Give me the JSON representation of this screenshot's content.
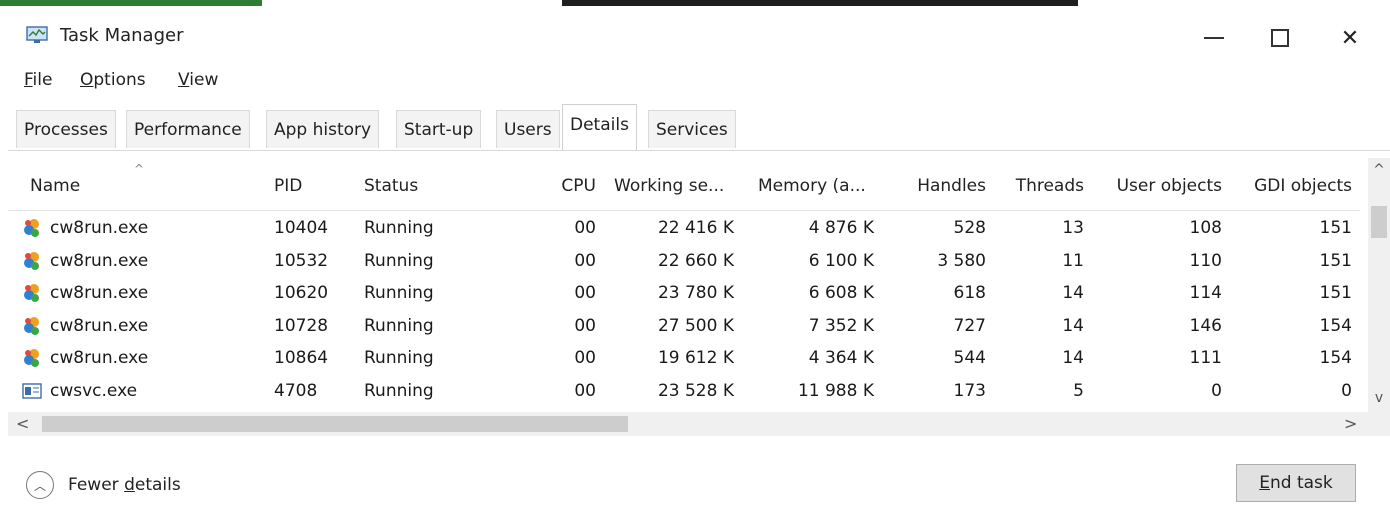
{
  "window": {
    "title": "Task Manager",
    "controls": {
      "minimize_icon": "minimize-icon",
      "maximize_icon": "maximize-icon",
      "close_label": "✕"
    }
  },
  "menu": {
    "file": {
      "first": "F",
      "rest": "ile"
    },
    "options": {
      "first": "O",
      "rest": "ptions"
    },
    "view": {
      "first": "V",
      "rest": "iew"
    }
  },
  "tabs": [
    "Processes",
    "Performance",
    "App history",
    "Start-up",
    "Users",
    "Details",
    "Services"
  ],
  "active_tab": "Details",
  "table": {
    "columns": {
      "name": "Name",
      "pid": "PID",
      "status": "Status",
      "cpu": "CPU",
      "working_set": "Working se...",
      "memory": "Memory (a...",
      "handles": "Handles",
      "threads": "Threads",
      "user_objects": "User objects",
      "gdi_objects": "GDI objects"
    },
    "sort_indicator": "^",
    "rows": [
      {
        "icon": "cw8run-icon",
        "name": "cw8run.exe",
        "pid": "10404",
        "status": "Running",
        "cpu": "00",
        "working_set": "22 416 K",
        "memory": "4 876 K",
        "handles": "528",
        "threads": "13",
        "user_objects": "108",
        "gdi_objects": "151"
      },
      {
        "icon": "cw8run-icon",
        "name": "cw8run.exe",
        "pid": "10532",
        "status": "Running",
        "cpu": "00",
        "working_set": "22 660 K",
        "memory": "6 100 K",
        "handles": "3 580",
        "threads": "11",
        "user_objects": "110",
        "gdi_objects": "151"
      },
      {
        "icon": "cw8run-icon",
        "name": "cw8run.exe",
        "pid": "10620",
        "status": "Running",
        "cpu": "00",
        "working_set": "23 780 K",
        "memory": "6 608 K",
        "handles": "618",
        "threads": "14",
        "user_objects": "114",
        "gdi_objects": "151"
      },
      {
        "icon": "cw8run-icon",
        "name": "cw8run.exe",
        "pid": "10728",
        "status": "Running",
        "cpu": "00",
        "working_set": "27 500 K",
        "memory": "7 352 K",
        "handles": "727",
        "threads": "14",
        "user_objects": "146",
        "gdi_objects": "154"
      },
      {
        "icon": "cw8run-icon",
        "name": "cw8run.exe",
        "pid": "10864",
        "status": "Running",
        "cpu": "00",
        "working_set": "19 612 K",
        "memory": "4 364 K",
        "handles": "544",
        "threads": "14",
        "user_objects": "111",
        "gdi_objects": "154"
      },
      {
        "icon": "service-icon",
        "name": "cwsvc.exe",
        "pid": "4708",
        "status": "Running",
        "cpu": "00",
        "working_set": "23 528 K",
        "memory": "11 988 K",
        "handles": "173",
        "threads": "5",
        "user_objects": "0",
        "gdi_objects": "0"
      }
    ]
  },
  "scroll": {
    "up": "^",
    "down": "v",
    "left": "<",
    "right": ">"
  },
  "footer": {
    "fewer_details_pre": "Fewer ",
    "fewer_details_u": "d",
    "fewer_details_post": "etails",
    "fewer_icon": "chevron-up-icon",
    "end_task_u": "E",
    "end_task_rest": "nd task"
  },
  "colors": {
    "accent_green": "#2e7d32",
    "button_bg": "#e1e1e1",
    "scroll_track": "#f0f0f0",
    "scroll_thumb": "#cdcdcd"
  }
}
